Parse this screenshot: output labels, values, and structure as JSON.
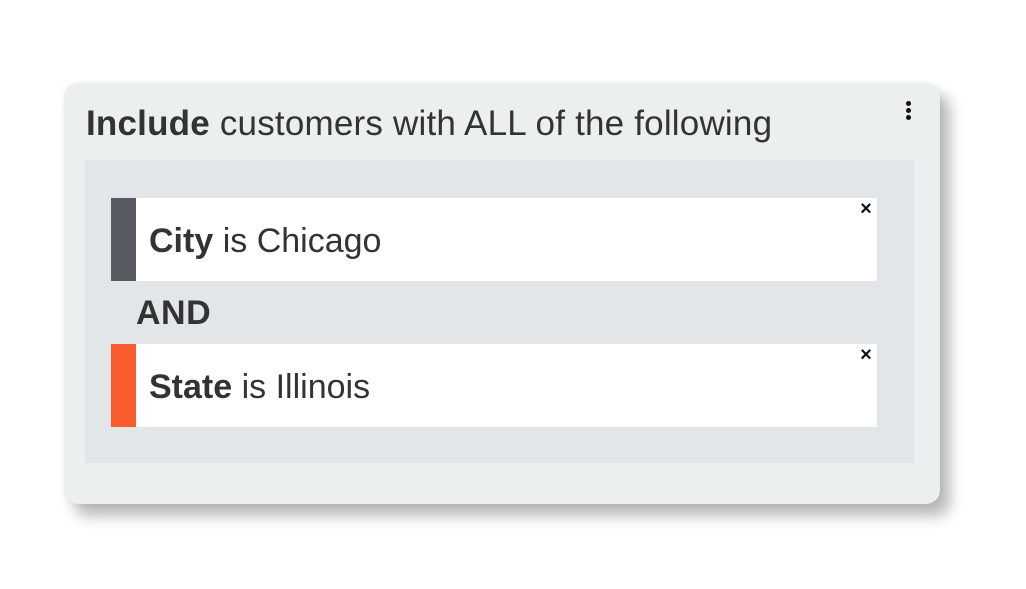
{
  "rule": {
    "action_label": "Include",
    "description": "customers with ALL of the following",
    "menu_icon": "vertical-ellipsis-icon"
  },
  "conditions": [
    {
      "field": "City",
      "operator_text": "is",
      "value": "Chicago",
      "accent_color": "#575b61",
      "remove_label": "×"
    },
    {
      "field": "State",
      "operator_text": "is",
      "value": "Illinois",
      "accent_color": "#f95b2f",
      "remove_label": "×"
    }
  ],
  "joiner": "AND",
  "colors": {
    "card_background": "#eceff0",
    "group_background": "#e2e6e8",
    "text": "#333333"
  }
}
